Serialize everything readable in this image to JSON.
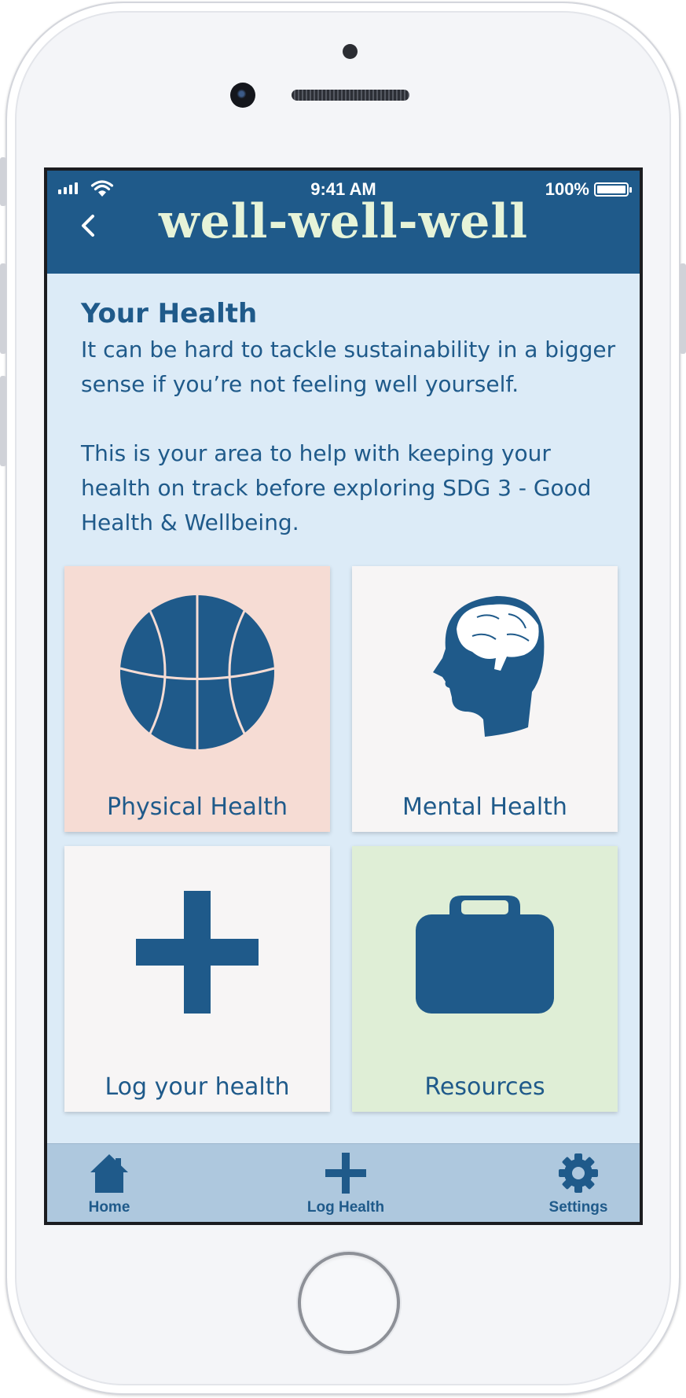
{
  "status_bar": {
    "time": "9:41 AM",
    "battery": "100%"
  },
  "header": {
    "title": "well-well-well"
  },
  "main": {
    "section_title": "Your Health",
    "intro": "It can be hard to tackle sustainability in a bigger sense if you’re not feeling well yourself.\n\nThis is your area to help with keeping your health on track before exploring SDG 3 - Good Health & Wellbeing.",
    "tiles": [
      {
        "label": "Physical Health",
        "icon": "basketball-icon",
        "color": "#f6dcd4"
      },
      {
        "label": "Mental Health",
        "icon": "head-brain-icon",
        "color": "#f7f5f5"
      },
      {
        "label": "Log your health",
        "icon": "plus-icon",
        "color": "#f7f5f5"
      },
      {
        "label": "Resources",
        "icon": "briefcase-icon",
        "color": "#dfeed6"
      }
    ]
  },
  "tab_bar": {
    "items": [
      {
        "label": "Home",
        "icon": "home-icon"
      },
      {
        "label": "Log Health",
        "icon": "plus-icon"
      },
      {
        "label": "Settings",
        "icon": "gear-icon"
      }
    ]
  },
  "colors": {
    "primary": "#1f5a8a",
    "title_text": "#e6f3d8",
    "background": "#dcebf7",
    "tab_bar": "#aec8de"
  }
}
